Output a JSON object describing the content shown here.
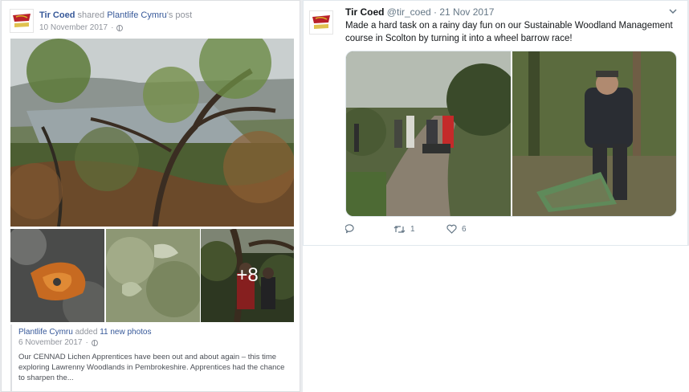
{
  "facebook_post": {
    "page_name": "Tir Coed",
    "action_text": "shared",
    "shared_from": "Plantlife Cymru",
    "shared_suffix": "'s post",
    "date": "10 November 2017",
    "more_photos_label": "+8",
    "original": {
      "author": "Plantlife Cymru",
      "action_text": "added",
      "photos_link": "11 new photos",
      "date": "6 November 2017",
      "body": "Our CENNAD Lichen Apprentices have been out and about again – this time exploring Lawrenny Woodlands in Pembrokeshire. Apprentices had the chance to sharpen the..."
    }
  },
  "tweet": {
    "name": "Tir Coed",
    "handle": "@tir_coed",
    "date": "21 Nov 2017",
    "separator": "·",
    "text": "Made a hard task on a rainy day fun on our Sustainable Woodland Management course in Scolton by turning it into a wheel barrow race!",
    "retweets": "1",
    "likes": "6"
  },
  "colors": {
    "fb_link": "#365899",
    "meta_gray": "#90949c",
    "tw_text": "#14171a",
    "tw_gray": "#657786",
    "logo_red": "#b9202a",
    "logo_yellow": "#d8b323"
  }
}
